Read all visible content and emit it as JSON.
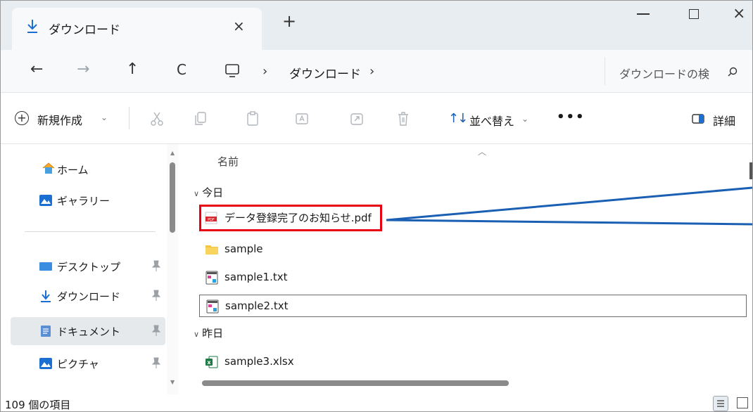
{
  "tab": {
    "title": "ダウンロード",
    "close": "×",
    "new_tab": "+"
  },
  "window": {
    "close": "×"
  },
  "nav": {
    "back": "←",
    "forward": "→",
    "up": "↑",
    "refresh": "C",
    "sep": "›",
    "breadcrumb": "ダウンロード",
    "search_placeholder": "ダウンロードの検"
  },
  "commands": {
    "new": "新規作成",
    "chevron": "⌄",
    "sort": "並べ替え",
    "sort_arrows": "↑↓",
    "more": "•••",
    "details": "詳細"
  },
  "sidebar": {
    "items": [
      {
        "label": "ホーム",
        "icon": "home-icon"
      },
      {
        "label": "ギャラリー",
        "icon": "gallery-icon"
      },
      {
        "label": "デスクトップ",
        "icon": "desktop-icon",
        "pinned": true
      },
      {
        "label": "ダウンロード",
        "icon": "download-icon",
        "pinned": true
      },
      {
        "label": "ドキュメント",
        "icon": "documents-icon",
        "pinned": true,
        "selected": true
      },
      {
        "label": "ピクチャ",
        "icon": "pictures-icon",
        "pinned": true
      }
    ]
  },
  "content": {
    "column_name": "名前",
    "groups": [
      {
        "label": "今日",
        "files": [
          {
            "name": "データ登録完了のお知らせ.pdf",
            "type": "pdf",
            "highlighted": true
          },
          {
            "name": "sample",
            "type": "folder"
          },
          {
            "name": "sample1.txt",
            "type": "txt"
          },
          {
            "name": "sample2.txt",
            "type": "txt",
            "focused": true
          }
        ]
      },
      {
        "label": "昨日",
        "files": [
          {
            "name": "sample3.xlsx",
            "type": "xlsx"
          }
        ]
      }
    ]
  },
  "status": {
    "item_count": "109 個の項目"
  },
  "colors": {
    "highlight": "#e60012",
    "callout": "#1a5fb4",
    "accent": "#1a5fb4",
    "folder": "#f4c542"
  }
}
